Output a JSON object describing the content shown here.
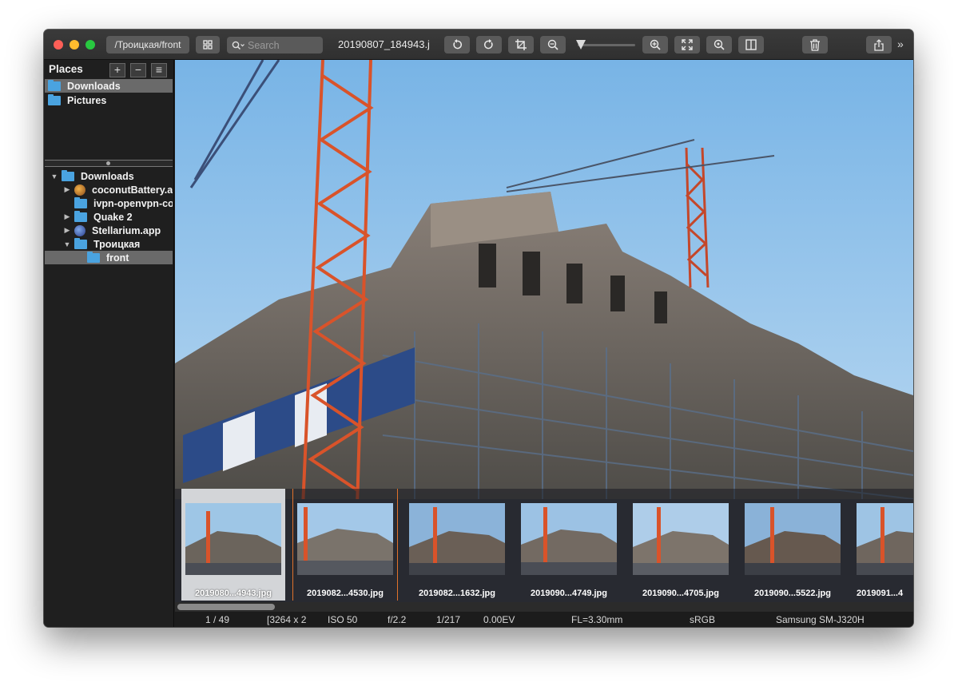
{
  "toolbar": {
    "path": "/Троицкая/front",
    "search_placeholder": "Search",
    "filename": "20190807_184943.j",
    "zoom_level": 0.05,
    "icons": [
      "grid-icon",
      "search-icon",
      "rotate-left-icon",
      "rotate-right-icon",
      "crop-icon",
      "zoom-out-icon",
      "zoom-in-icon",
      "fit-screen-icon",
      "actual-size-icon",
      "split-view-icon",
      "trash-icon",
      "share-icon",
      "more-icon"
    ],
    "more": "»"
  },
  "sidebar": {
    "places_title": "Places",
    "add_label": "+",
    "remove_label": "−",
    "menu_label": "≡",
    "places": [
      {
        "label": "Downloads",
        "selected": true
      },
      {
        "label": "Pictures",
        "selected": false
      }
    ],
    "tree": [
      {
        "label": "Downloads",
        "expanded": true
      },
      {
        "label": "coconutBattery.app"
      },
      {
        "label": "ivpn-openvpn-config"
      },
      {
        "label": "Quake 2"
      },
      {
        "label": "Stellarium.app"
      },
      {
        "label": "Троицкая",
        "expanded": true
      },
      {
        "label": "front",
        "selected": true
      }
    ]
  },
  "filmstrip": [
    {
      "label": "2019080...4943.jpg",
      "selected": true
    },
    {
      "label": "2019082...4530.jpg",
      "selected": false
    },
    {
      "label": "2019082...1632.jpg",
      "selected": false
    },
    {
      "label": "2019090...4749.jpg",
      "selected": false
    },
    {
      "label": "2019090...4705.jpg",
      "selected": false
    },
    {
      "label": "2019090...5522.jpg",
      "selected": false
    },
    {
      "label": "2019091...4",
      "selected": false
    }
  ],
  "status": {
    "index": "1 / 49",
    "dimensions": "[3264 x 2",
    "iso": "ISO 50",
    "aperture": "f/2.2",
    "shutter": "1/217",
    "ev": "0.00EV",
    "focal": "FL=3.30mm",
    "colorspace": "sRGB",
    "camera": "Samsung SM-J320H"
  },
  "colors": {
    "folder": "#4aa3e0",
    "selection": "#6a6a6a",
    "accent_divider": "#e0722b",
    "crane": "#d9532a"
  }
}
